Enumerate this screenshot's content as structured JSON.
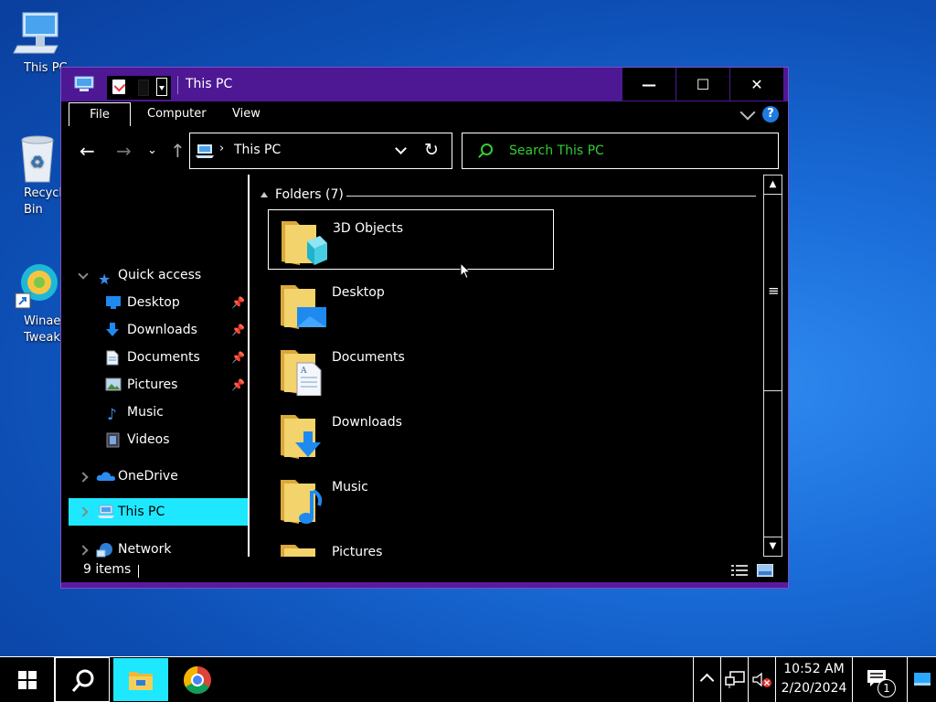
{
  "desktop": {
    "icons": [
      {
        "label": "This PC",
        "icon": "this-pc-icon"
      },
      {
        "label": "Recycle Bin",
        "icon": "recycle-bin-icon"
      },
      {
        "label": "Winaero Tweaker",
        "icon": "winaero-icon"
      }
    ]
  },
  "window": {
    "title": "This PC",
    "controls": {
      "minimize": "—",
      "maximize": "☐",
      "close": "✕"
    },
    "ribbon": {
      "tabs": [
        "File",
        "Computer",
        "View"
      ],
      "help": "?"
    },
    "address": {
      "crumb": "This PC"
    },
    "search": {
      "placeholder": "Search This PC"
    },
    "nav": {
      "items": [
        {
          "label": "Quick access",
          "icon": "star-icon"
        },
        {
          "label": "Desktop",
          "icon": "desktop-icon",
          "pinned": true
        },
        {
          "label": "Downloads",
          "icon": "download-icon",
          "pinned": true
        },
        {
          "label": "Documents",
          "icon": "documents-icon",
          "pinned": true
        },
        {
          "label": "Pictures",
          "icon": "pictures-icon",
          "pinned": true
        },
        {
          "label": "Music",
          "icon": "music-icon"
        },
        {
          "label": "Videos",
          "icon": "videos-icon"
        },
        {
          "label": "OneDrive",
          "icon": "onedrive-icon"
        },
        {
          "label": "This PC",
          "icon": "this-pc-icon"
        },
        {
          "label": "Network",
          "icon": "network-icon"
        }
      ]
    },
    "content": {
      "group_header": "Folders (7)",
      "folders": [
        {
          "name": "3D Objects",
          "overlay": "cube-icon"
        },
        {
          "name": "Desktop",
          "overlay": "desktop-icon"
        },
        {
          "name": "Documents",
          "overlay": "document-icon"
        },
        {
          "name": "Downloads",
          "overlay": "download-arrow-icon"
        },
        {
          "name": "Music",
          "overlay": "music-note-icon"
        },
        {
          "name": "Pictures",
          "overlay": "picture-icon"
        }
      ]
    },
    "status": {
      "items_count": "9 items"
    }
  },
  "taskbar": {
    "clock_time": "10:52 AM",
    "clock_date": "2/20/2024",
    "notification_count": "1"
  },
  "colors": {
    "accent_cyan": "#1ee8ff",
    "title_purple": "#4e1895",
    "search_green": "#33cc33"
  }
}
